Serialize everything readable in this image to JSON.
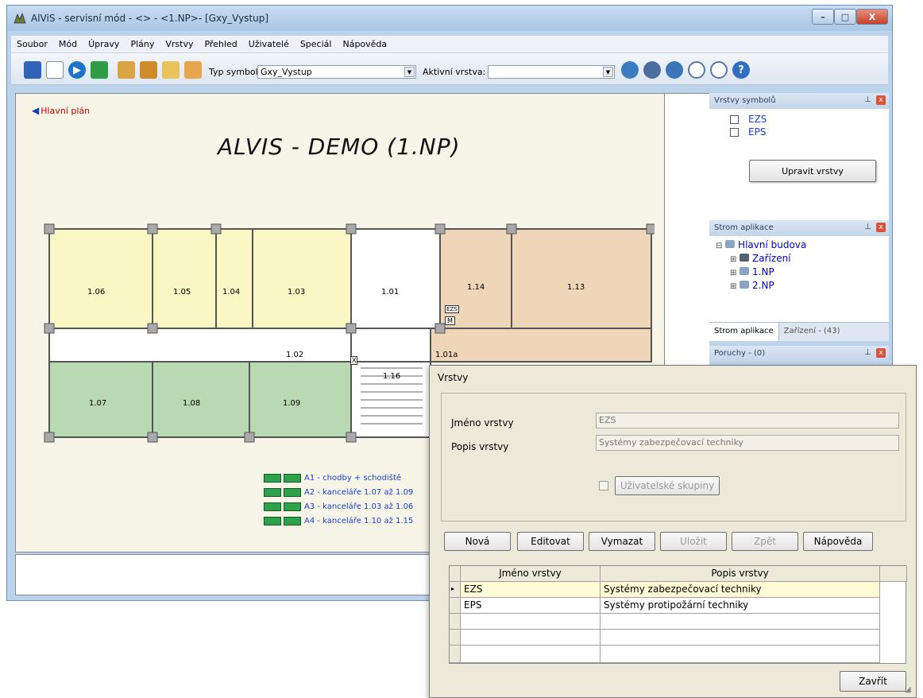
{
  "window": {
    "title": "AlViS - servisní mód - <> - <1.NP>- [Gxy_Vystup]",
    "controls": {
      "minimize": "–",
      "maximize": "□",
      "close": "X"
    }
  },
  "menu": [
    "Soubor",
    "Mód",
    "Úpravy",
    "Plány",
    "Vrstvy",
    "Přehled",
    "Uživatelé",
    "Speciál",
    "Nápověda"
  ],
  "toolbar": {
    "symbol_type_label": "Typ symbolu:",
    "symbol_type_value": "Gxy_Vystup",
    "active_layer_label": "Aktivní vrstva:",
    "active_layer_value": ""
  },
  "plan": {
    "back_link": "Hlavní plán",
    "title": "ALVIS - DEMO (1.NP)",
    "rooms": [
      "1.06",
      "1.05",
      "1.04",
      "1.03",
      "1.01",
      "1.14",
      "1.13",
      "1.02",
      "1.01a",
      "1.16",
      "1.07",
      "1.08",
      "1.09"
    ],
    "room_symbols": {
      "ezs": "EZS",
      "m": "M",
      "x": "X"
    },
    "legend": [
      {
        "text": "A1 - chodby + schodiště"
      },
      {
        "text": "A2 - kanceláře 1.07 až 1.09"
      },
      {
        "text": "A3 - kanceláře 1.03 až 1.06"
      },
      {
        "text": "A4 - kanceláře 1.10 až 1.15"
      }
    ]
  },
  "panels": {
    "layers": {
      "title": "Vrstvy symbolů",
      "items": [
        "EZS",
        "EPS"
      ],
      "edit_button": "Upravit vrstvy"
    },
    "app_tree": {
      "title": "Strom aplikace",
      "items": [
        "Hlavní budova",
        "Zařízení",
        "1.NP",
        "2.NP"
      ],
      "tabs": [
        "Strom aplikace",
        "Zařízení - (43)"
      ]
    },
    "faults": {
      "title": "Poruchy - (0)"
    }
  },
  "dialog": {
    "title": "Vrstvy",
    "name_label": "Jméno vrstvy",
    "name_value": "EZS",
    "desc_label": "Popis vrstvy",
    "desc_value": "Systémy zabezpečovací techniky",
    "user_groups_label": "Uživatelské skupiny",
    "buttons": [
      "Nová",
      "Editovat",
      "Vymazat",
      "Uložit",
      "Zpět",
      "Nápověda"
    ],
    "table": {
      "headers": [
        "Jméno vrstvy",
        "Popis vrstvy"
      ],
      "rows": [
        [
          "EZS",
          "Systémy zabezpečovací techniky"
        ],
        [
          "EPS",
          "Systémy protipožární techniky"
        ]
      ]
    },
    "close_button": "Zavřít"
  }
}
